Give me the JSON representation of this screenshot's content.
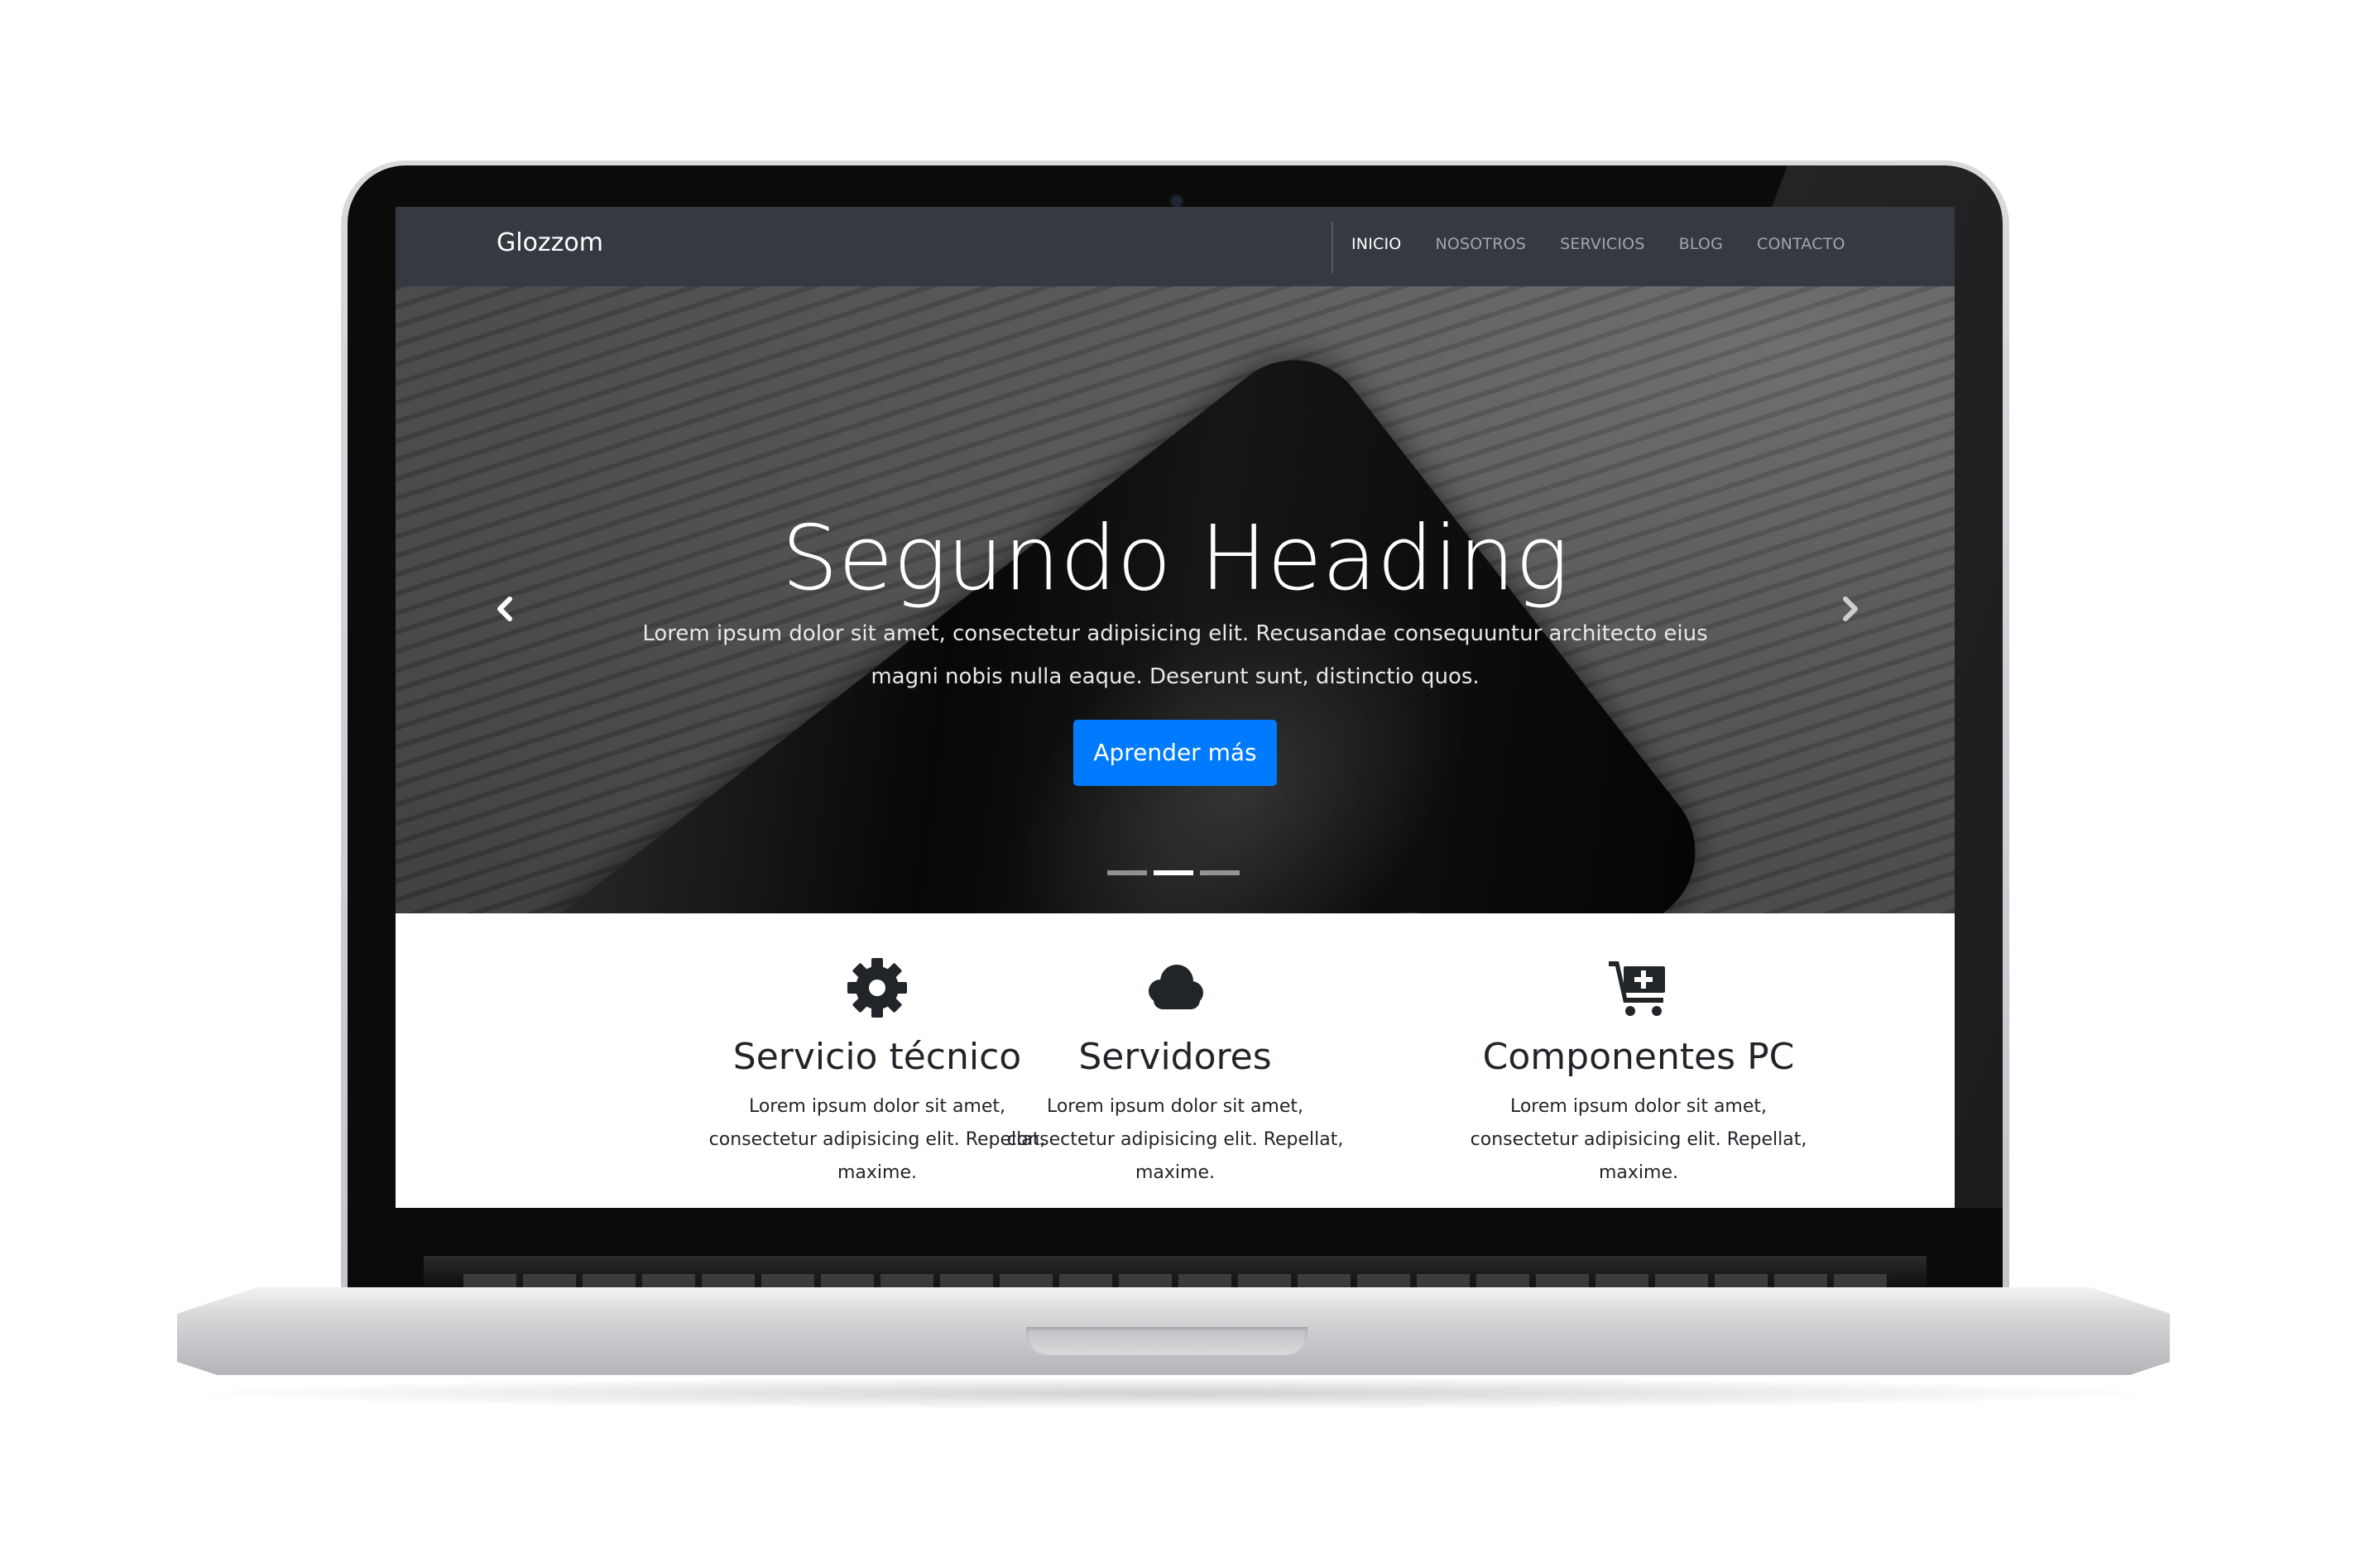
{
  "navbar": {
    "brand": "Glozzom",
    "links": [
      {
        "label": "INICIO",
        "active": true
      },
      {
        "label": "NOSOTROS",
        "active": false
      },
      {
        "label": "SERVICIOS",
        "active": false
      },
      {
        "label": "BLOG",
        "active": false
      },
      {
        "label": "CONTACTO",
        "active": false
      }
    ]
  },
  "carousel": {
    "heading": "Segundo Heading",
    "text": "Lorem ipsum dolor sit amet, consectetur adipisicing elit. Recusandae consequuntur architecto eius magni nobis nulla eaque. Deserunt sunt, distinctio quos.",
    "button_label": "Aprender más",
    "prev_icon": "chevron-left-icon",
    "next_icon": "chevron-right-icon",
    "indicator_count": 3,
    "active_indicator": 2
  },
  "features": [
    {
      "icon": "gear-icon",
      "title": "Servicio técnico",
      "text": "Lorem ipsum dolor sit amet, consectetur adipisicing elit. Repellat, maxime."
    },
    {
      "icon": "cloud-icon",
      "title": "Servidores",
      "text": "Lorem ipsum dolor sit amet, consectetur adipisicing elit. Repellat, maxime."
    },
    {
      "icon": "cart-plus-icon",
      "title": "Componentes PC",
      "text": "Lorem ipsum dolor sit amet, consectetur adipisicing elit. Repellat, maxime."
    }
  ],
  "colors": {
    "navbar_bg": "#343a40",
    "button_bg": "#007bff",
    "text_dark": "#212529"
  }
}
